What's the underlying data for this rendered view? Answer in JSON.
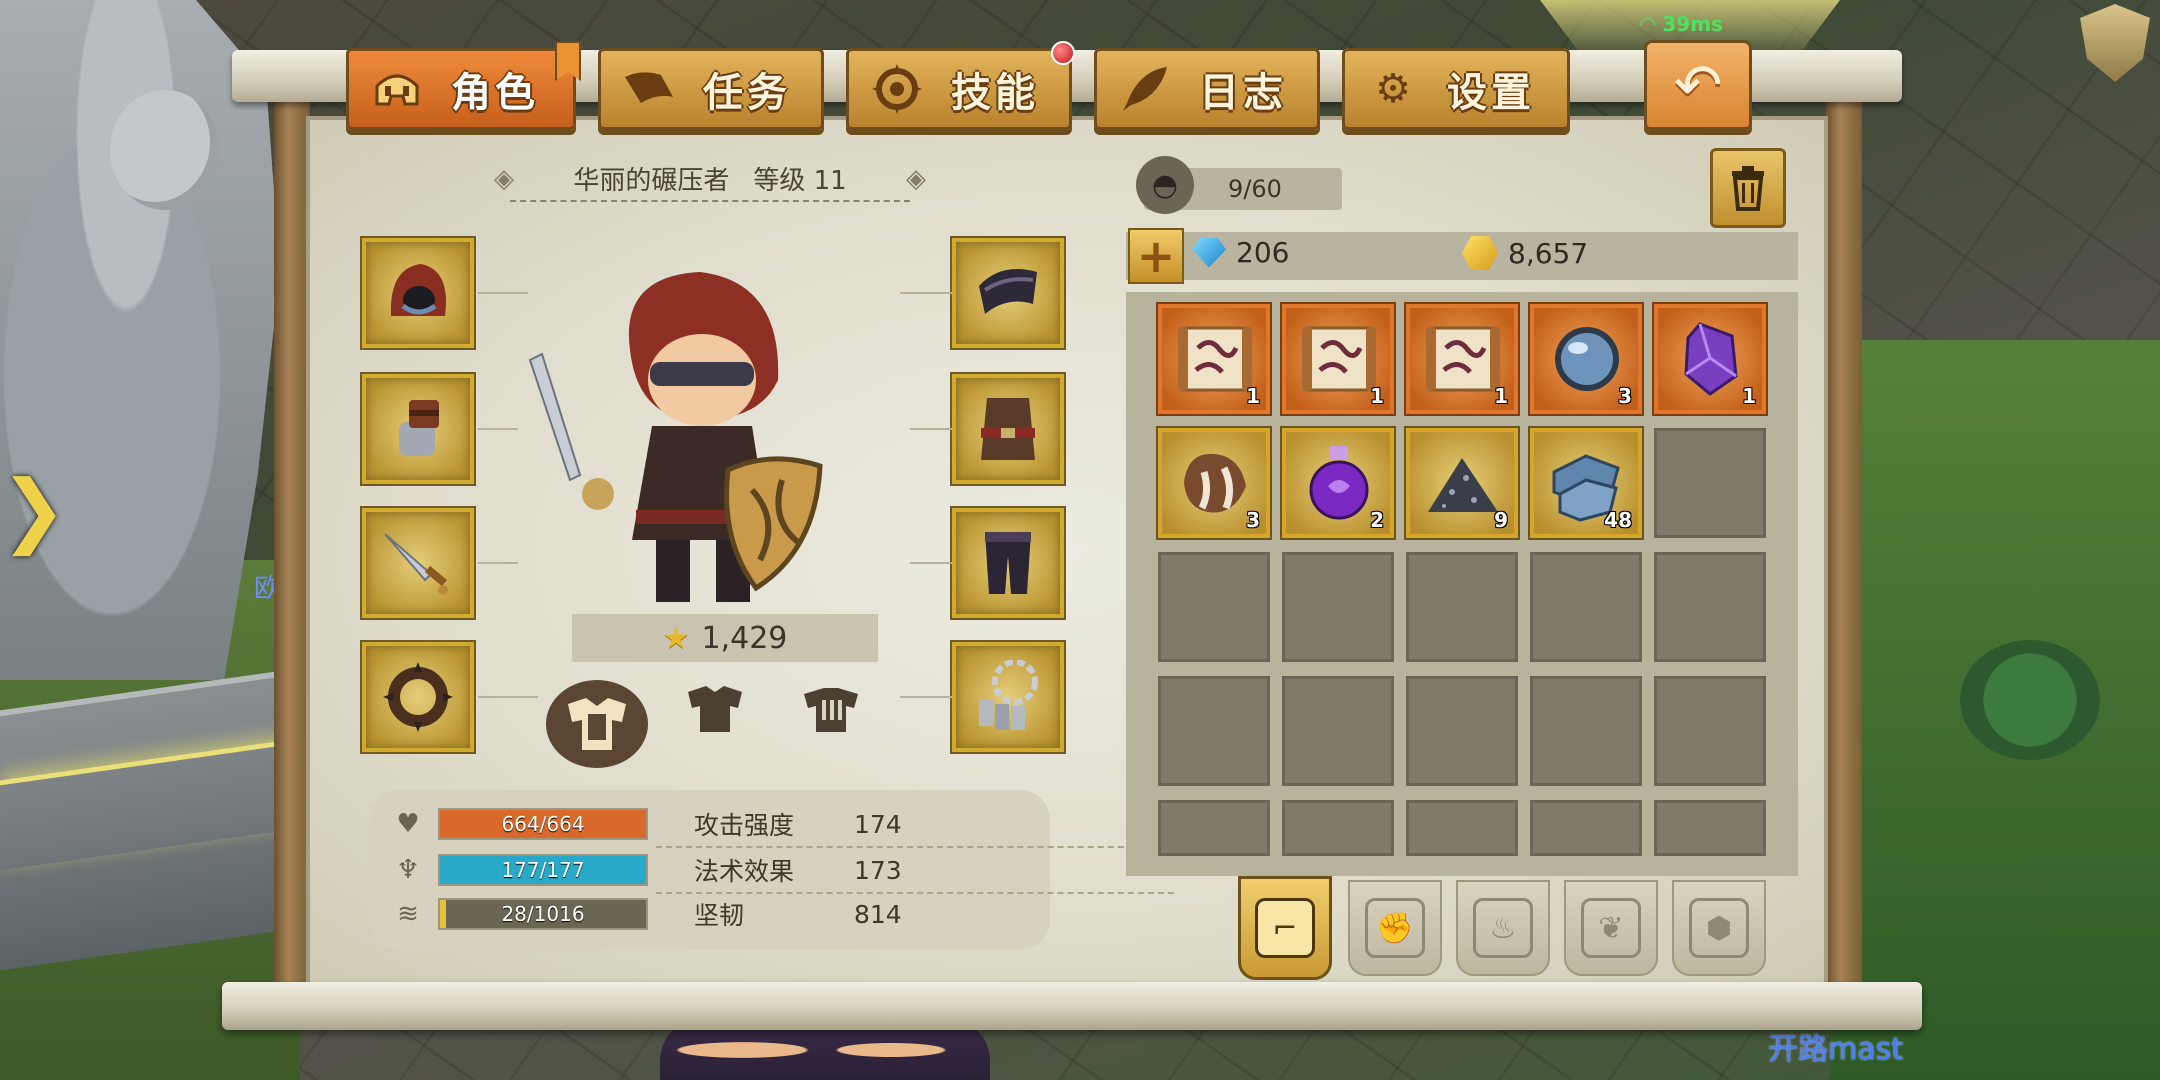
{
  "status": {
    "ping": "39ms"
  },
  "tabs": [
    {
      "label": "角色",
      "icon": "helmet-icon",
      "active": true
    },
    {
      "label": "任务",
      "icon": "scroll-icon",
      "active": false
    },
    {
      "label": "技能",
      "icon": "skill-compass-icon",
      "active": false,
      "badge": true
    },
    {
      "label": "日志",
      "icon": "quill-icon",
      "active": false
    },
    {
      "label": "设置",
      "icon": "gear-icon",
      "active": false
    }
  ],
  "back_button": {
    "icon": "back-arrow-icon"
  },
  "character": {
    "name": "华丽的碾压者",
    "level_label": "等级 11",
    "power": "1,429",
    "equipment_left": [
      "hood-icon",
      "gauntlet-icon",
      "sword-icon",
      "spiked-ring-icon"
    ],
    "equipment_right": [
      "shoulder-icon",
      "chest-armor-icon",
      "leg-armor-icon",
      "chain-necklace-icon"
    ],
    "gear_sets": [
      "armor-set-1-icon",
      "armor-set-2-icon",
      "armor-set-3-icon"
    ]
  },
  "stats": {
    "hp": {
      "text": "664/664",
      "fill": 1.0,
      "color": "#d9692a"
    },
    "mana": {
      "text": "177/177",
      "fill": 1.0,
      "color": "#28a9c9"
    },
    "xp": {
      "text": "28/1016",
      "fill": 0.028,
      "color": "#e6c23a"
    },
    "attributes": [
      {
        "label": "攻击强度",
        "value": "174"
      },
      {
        "label": "法术效果",
        "value": "173"
      },
      {
        "label": "坚韧",
        "value": "814"
      }
    ]
  },
  "inventory": {
    "capacity": "9/60",
    "gems": "206",
    "gold": "8,657",
    "items": [
      {
        "icon": "recipe-scroll-icon",
        "qty": "1",
        "rarity": "orange"
      },
      {
        "icon": "recipe-scroll-icon",
        "qty": "1",
        "rarity": "orange"
      },
      {
        "icon": "recipe-scroll-icon",
        "qty": "1",
        "rarity": "orange"
      },
      {
        "icon": "blue-orb-icon",
        "qty": "3",
        "rarity": "orange"
      },
      {
        "icon": "purple-crystal-icon",
        "qty": "1",
        "rarity": "orange"
      },
      {
        "icon": "leather-hide-icon",
        "qty": "3",
        "rarity": "gold"
      },
      {
        "icon": "purple-potion-icon",
        "qty": "2",
        "rarity": "gold"
      },
      {
        "icon": "ore-pile-icon",
        "qty": "9",
        "rarity": "gold"
      },
      {
        "icon": "steel-ingot-icon",
        "qty": "48",
        "rarity": "gold"
      }
    ],
    "categories": [
      "all-items-icon",
      "materials-icon",
      "potion-icon",
      "leaf-icon",
      "gemstone-icon"
    ]
  },
  "player_name": "开路mast",
  "side_glyph": "欧"
}
